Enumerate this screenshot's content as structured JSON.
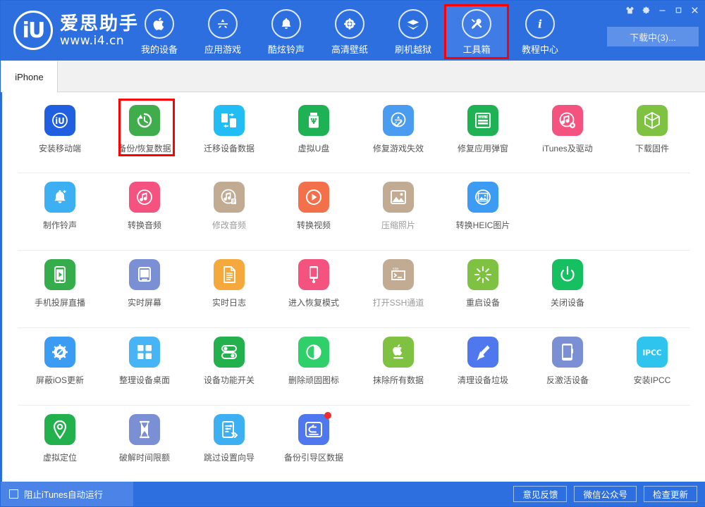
{
  "header": {
    "logo": {
      "mark": "iU",
      "title": "爱思助手",
      "subtitle": "www.i4.cn"
    },
    "nav": [
      {
        "label": "我的设备",
        "icon": "apple-icon",
        "active": false,
        "highlighted": false
      },
      {
        "label": "应用游戏",
        "icon": "appstore-icon",
        "active": false,
        "highlighted": false
      },
      {
        "label": "酷炫铃声",
        "icon": "bell-icon",
        "active": false,
        "highlighted": false
      },
      {
        "label": "高清壁纸",
        "icon": "flower-icon",
        "active": false,
        "highlighted": false
      },
      {
        "label": "刷机越狱",
        "icon": "box-open-icon",
        "active": false,
        "highlighted": false
      },
      {
        "label": "工具箱",
        "icon": "tools-icon",
        "active": true,
        "highlighted": true
      },
      {
        "label": "教程中心",
        "icon": "info-icon",
        "active": false,
        "highlighted": false
      }
    ],
    "window_buttons": [
      {
        "name": "skin-icon",
        "glyph": "tshirt"
      },
      {
        "name": "settings-gear-icon",
        "glyph": "gear"
      },
      {
        "name": "minimize-icon",
        "glyph": "minimize"
      },
      {
        "name": "maximize-icon",
        "glyph": "maximize"
      },
      {
        "name": "close-icon",
        "glyph": "close"
      }
    ],
    "download_button": "下载中(3)..."
  },
  "tabs": [
    {
      "label": "iPhone",
      "active": true
    }
  ],
  "tool_rows": [
    [
      {
        "label": "安装移动端",
        "icon": "i4-app-icon",
        "color": "#1f5fe0",
        "disabled": false,
        "badge": false,
        "highlighted": false
      },
      {
        "label": "备份/恢复数据",
        "icon": "backup-restore-icon",
        "color": "#3fad4b",
        "disabled": false,
        "badge": false,
        "highlighted": true
      },
      {
        "label": "迁移设备数据",
        "icon": "device-transfer-icon",
        "color": "#22bdf5",
        "disabled": false,
        "badge": false,
        "highlighted": false
      },
      {
        "label": "虚拟U盘",
        "icon": "usb-drive-icon",
        "color": "#1fb255",
        "disabled": false,
        "badge": false,
        "highlighted": false
      },
      {
        "label": "修复游戏失效",
        "icon": "appstore-check-icon",
        "color": "#4a9cf0",
        "disabled": false,
        "badge": false,
        "highlighted": false
      },
      {
        "label": "修复应用弹窗",
        "icon": "apple-id-card-icon",
        "color": "#1fb255",
        "disabled": false,
        "badge": false,
        "highlighted": false
      },
      {
        "label": "iTunes及驱动",
        "icon": "itunes-gear-icon",
        "color": "#f4527f",
        "disabled": false,
        "badge": false,
        "highlighted": false
      },
      {
        "label": "下载固件",
        "icon": "firmware-box-icon",
        "color": "#7fc242",
        "disabled": false,
        "badge": false,
        "highlighted": false
      }
    ],
    [
      {
        "label": "制作铃声",
        "icon": "ringtone-bell-icon",
        "color": "#3cb0f3",
        "disabled": false,
        "badge": false,
        "highlighted": false
      },
      {
        "label": "转换音频",
        "icon": "audio-convert-icon",
        "color": "#f4527f",
        "disabled": false,
        "badge": false,
        "highlighted": false
      },
      {
        "label": "修改音频",
        "icon": "audio-edit-icon",
        "color": "#c2ab93",
        "disabled": true,
        "badge": false,
        "highlighted": false
      },
      {
        "label": "转换视频",
        "icon": "video-convert-icon",
        "color": "#f2714a",
        "disabled": false,
        "badge": false,
        "highlighted": false
      },
      {
        "label": "压缩照片",
        "icon": "compress-photo-icon",
        "color": "#c2ab93",
        "disabled": true,
        "badge": false,
        "highlighted": false
      },
      {
        "label": "转换HEIC图片",
        "icon": "heic-convert-icon",
        "color": "#3c9cf3",
        "disabled": false,
        "badge": false,
        "highlighted": false
      }
    ],
    [
      {
        "label": "手机投屏直播",
        "icon": "screen-cast-icon",
        "color": "#34ad4a",
        "disabled": false,
        "badge": false,
        "highlighted": false
      },
      {
        "label": "实时屏幕",
        "icon": "realtime-screen-icon",
        "color": "#7b8fd4",
        "disabled": false,
        "badge": false,
        "highlighted": false
      },
      {
        "label": "实时日志",
        "icon": "realtime-log-icon",
        "color": "#f5a93c",
        "disabled": false,
        "badge": false,
        "highlighted": false
      },
      {
        "label": "进入恢复模式",
        "icon": "recovery-mode-icon",
        "color": "#f4527f",
        "disabled": false,
        "badge": false,
        "highlighted": false
      },
      {
        "label": "打开SSH通道",
        "icon": "ssh-terminal-icon",
        "color": "#c2ab93",
        "disabled": true,
        "badge": false,
        "highlighted": false
      },
      {
        "label": "重启设备",
        "icon": "restart-device-icon",
        "color": "#7fc242",
        "disabled": false,
        "badge": false,
        "highlighted": false
      },
      {
        "label": "关闭设备",
        "icon": "power-off-icon",
        "color": "#16c060",
        "disabled": false,
        "badge": false,
        "highlighted": false
      }
    ],
    [
      {
        "label": "屏蔽iOS更新",
        "icon": "block-ios-update-icon",
        "color": "#3c9cf3",
        "disabled": false,
        "badge": false,
        "highlighted": false
      },
      {
        "label": "整理设备桌面",
        "icon": "organize-desktop-icon",
        "color": "#46b4f5",
        "disabled": false,
        "badge": false,
        "highlighted": false
      },
      {
        "label": "设备功能开关",
        "icon": "feature-toggle-icon",
        "color": "#22b14c",
        "disabled": false,
        "badge": false,
        "highlighted": false
      },
      {
        "label": "删除顽固图标",
        "icon": "remove-icon-icon",
        "color": "#2fd06a",
        "disabled": false,
        "badge": false,
        "highlighted": false
      },
      {
        "label": "抹除所有数据",
        "icon": "erase-all-icon",
        "color": "#7fc242",
        "disabled": false,
        "badge": false,
        "highlighted": false
      },
      {
        "label": "清理设备垃圾",
        "icon": "clean-junk-icon",
        "color": "#4f78ef",
        "disabled": false,
        "badge": false,
        "highlighted": false
      },
      {
        "label": "反激活设备",
        "icon": "deactivate-device-icon",
        "color": "#7b8fd4",
        "disabled": false,
        "badge": false,
        "highlighted": false
      },
      {
        "label": "安装IPCC",
        "icon": "ipcc-icon",
        "color": "#2fc4ee",
        "disabled": false,
        "badge": false,
        "highlighted": false
      }
    ],
    [
      {
        "label": "虚拟定位",
        "icon": "virtual-location-icon",
        "color": "#22b14c",
        "disabled": false,
        "badge": false,
        "highlighted": false
      },
      {
        "label": "破解时间限额",
        "icon": "time-limit-icon",
        "color": "#7b8fd4",
        "disabled": false,
        "badge": false,
        "highlighted": false
      },
      {
        "label": "跳过设置向导",
        "icon": "skip-setup-icon",
        "color": "#3cb0f3",
        "disabled": false,
        "badge": false,
        "highlighted": false
      },
      {
        "label": "备份引导区数据",
        "icon": "backup-boot-icon",
        "color": "#4f78ef",
        "disabled": false,
        "badge": true,
        "highlighted": false
      }
    ]
  ],
  "footer": {
    "checkbox_label": "阻止iTunes自动运行",
    "checkbox_checked": false,
    "buttons": [
      {
        "label": "意见反馈"
      },
      {
        "label": "微信公众号"
      },
      {
        "label": "检查更新"
      }
    ]
  },
  "colors": {
    "brand_blue": "#2e6fe0",
    "highlight_red": "#ff0000",
    "active_nav": "#407ce6",
    "disabled_tan": "#c2ab93"
  }
}
